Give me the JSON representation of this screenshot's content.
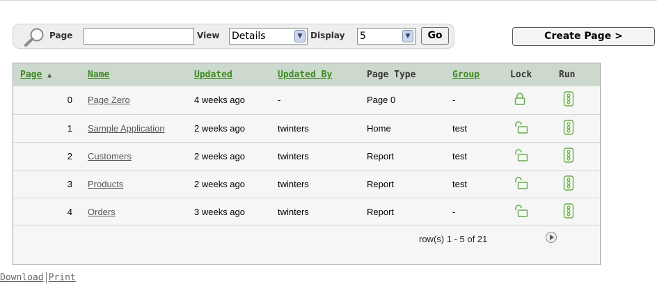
{
  "search": {
    "page_label": "Page",
    "search_value": "",
    "view_label": "View",
    "view_value": "Details",
    "display_label": "Display",
    "display_value": "5",
    "go_label": "Go"
  },
  "create_page_label": "Create Page >",
  "report": {
    "columns": [
      "Page",
      "Name",
      "Updated",
      "Updated By",
      "Page Type",
      "Group",
      "Lock",
      "Run"
    ],
    "sort_indicator": "▲",
    "rows": [
      {
        "page": "0",
        "name": "Page Zero",
        "updated": "4 weeks ago",
        "updated_by": "-",
        "page_type": "Page 0",
        "group": "-",
        "lock_icon": "locked-icon",
        "run_icon": "run-icon"
      },
      {
        "page": "1",
        "name": "Sample Application",
        "updated": "2 weeks ago",
        "updated_by": "twinters",
        "page_type": "Home",
        "group": "test",
        "lock_icon": "unlocked-icon",
        "run_icon": "run-icon"
      },
      {
        "page": "2",
        "name": "Customers",
        "updated": "2 weeks ago",
        "updated_by": "twinters",
        "page_type": "Report",
        "group": "test",
        "lock_icon": "unlocked-icon",
        "run_icon": "run-icon"
      },
      {
        "page": "3",
        "name": "Products",
        "updated": "2 weeks ago",
        "updated_by": "twinters",
        "page_type": "Report",
        "group": "test",
        "lock_icon": "unlocked-icon",
        "run_icon": "run-icon"
      },
      {
        "page": "4",
        "name": "Orders",
        "updated": "3 weeks ago",
        "updated_by": "twinters",
        "page_type": "Report",
        "group": "-",
        "lock_icon": "unlocked-icon",
        "run_icon": "run-icon"
      }
    ],
    "pagination": "row(s) 1 - 5 of 21"
  },
  "links": {
    "download": "Download",
    "print": "Print"
  },
  "colors": {
    "header_bg": "#ced9ce",
    "sort_link": "#3a8a1f",
    "icon_green": "#5a9a3a"
  }
}
